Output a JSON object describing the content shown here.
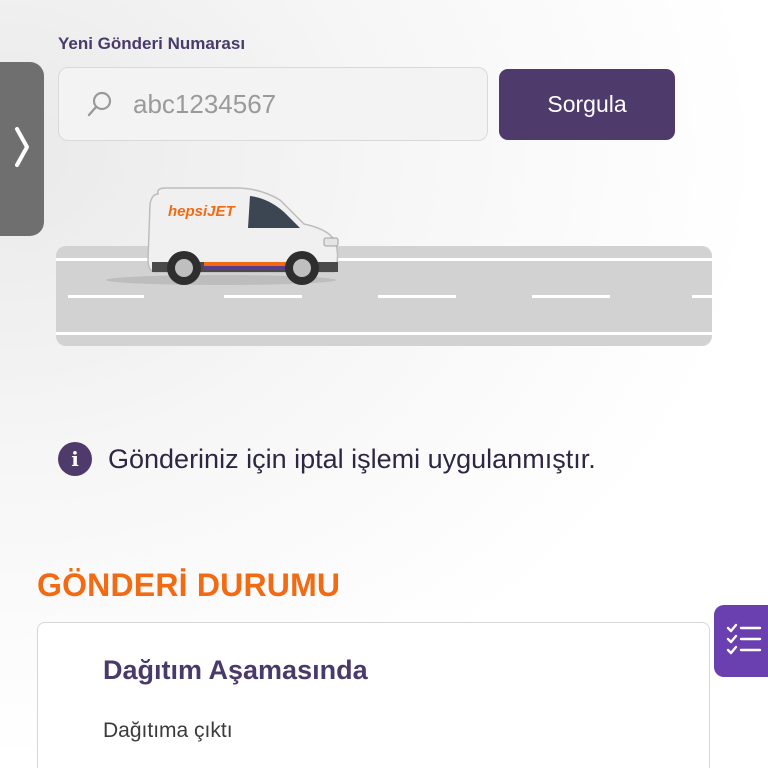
{
  "search": {
    "label": "Yeni Gönderi Numarası",
    "placeholder": "abc1234567",
    "button_label": "Sorgula",
    "icon": "search-icon"
  },
  "side_panel": {
    "icon": "chevron-right-icon"
  },
  "illustration": {
    "van_brand": "hepsiJET",
    "icon": "delivery-van-icon"
  },
  "notice": {
    "icon": "info-icon",
    "text": "Gönderiniz için iptal işlemi uygulanmıştır."
  },
  "status": {
    "heading": "GÖNDERİ DURUMU",
    "title": "Dağıtım Aşamasında",
    "detail": "Dağıtıma çıktı"
  },
  "fab": {
    "icon": "checklist-icon"
  },
  "colors": {
    "brand_purple": "#4e3a6b",
    "accent_orange": "#f26a12",
    "fab_purple": "#6a3fb0"
  }
}
